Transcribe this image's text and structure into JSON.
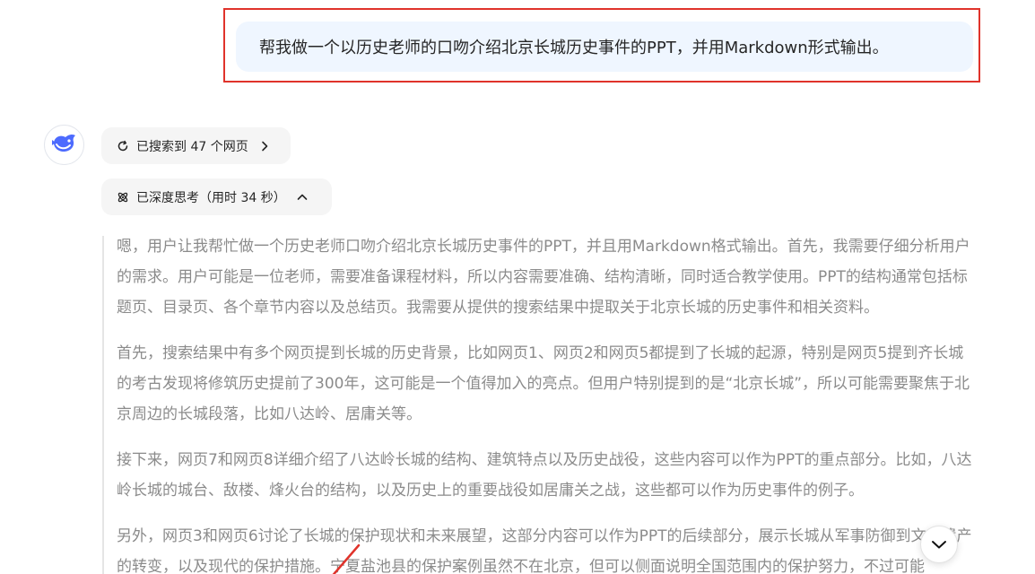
{
  "user_message": {
    "text": "帮我做一个以历史老师的口吻介绍北京长城历史事件的PPT，并用Markdown形式输出。"
  },
  "assistant": {
    "avatar_icon": "whale-logo-icon",
    "search_status": {
      "label": "已搜索到 47 个网页",
      "icon": "search-refresh-icon",
      "chevron": "chevron-right-icon"
    },
    "thinking_status": {
      "label": "已深度思考（用时 34 秒）",
      "icon": "deep-think-icon",
      "chevron": "chevron-up-icon"
    },
    "thought_paragraphs": [
      "嗯，用户让我帮忙做一个历史老师口吻介绍北京长城历史事件的PPT，并且用Markdown格式输出。首先，我需要仔细分析用户的需求。用户可能是一位老师，需要准备课程材料，所以内容需要准确、结构清晰，同时适合教学使用。PPT的结构通常包括标题页、目录页、各个章节内容以及总结页。我需要从提供的搜索结果中提取关于北京长城的历史事件和相关资料。",
      "首先，搜索结果中有多个网页提到长城的历史背景，比如网页1、网页2和网页5都提到了长城的起源，特别是网页5提到齐长城的考古发现将修筑历史提前了300年，这可能是一个值得加入的亮点。但用户特别提到的是“北京长城”，所以可能需要聚焦于北京周边的长城段落，比如八达岭、居庸关等。",
      "接下来，网页7和网页8详细介绍了八达岭长城的结构、建筑特点以及历史战役，这些内容可以作为PPT的重点部分。比如，八达岭长城的城台、敌楼、烽火台的结构，以及历史上的重要战役如居庸关之战，这些都可以作为历史事件的例子。",
      "另外，网页3和网页6讨论了长城的保护现状和未来展望，这部分内容可以作为PPT的后续部分，展示长城从军事防御到文化遗产的转变，以及现代的保护措施。宁夏盐池县的保护案例虽然不在北京，但可以侧面说明全国范围内的保护努力，不过可能"
    ]
  },
  "controls": {
    "scroll_down_icon": "chevron-down-icon"
  },
  "colors": {
    "highlight_border": "#e0332b",
    "user_bubble_bg": "#eff6ff",
    "pill_bg": "#f5f5f5",
    "thought_text": "#8b8b8b",
    "brand_blue": "#4d6bfe"
  }
}
